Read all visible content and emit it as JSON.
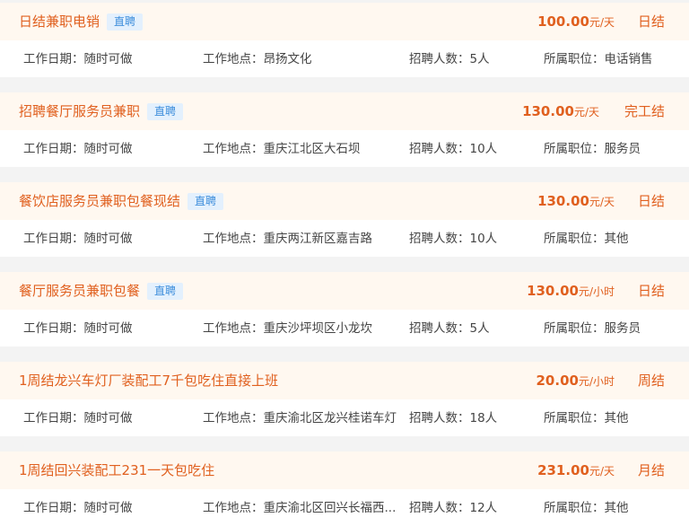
{
  "labels": {
    "date": "工作日期：",
    "location": "工作地点：",
    "count": "招聘人数：",
    "position": "所属职位："
  },
  "jobs": [
    {
      "title": "日结兼职电销",
      "tag": "直聘",
      "salary": "100.00",
      "unit": "元/天",
      "settle": "日结",
      "date": "随时可做",
      "location": "昂扬文化",
      "count": "5人",
      "position": "电话销售"
    },
    {
      "title": "招聘餐厅服务员兼职",
      "tag": "直聘",
      "salary": "130.00",
      "unit": "元/天",
      "settle": "完工结",
      "date": "随时可做",
      "location": "重庆江北区大石坝",
      "count": "10人",
      "position": "服务员"
    },
    {
      "title": "餐饮店服务员兼职包餐现结",
      "tag": "直聘",
      "salary": "130.00",
      "unit": "元/天",
      "settle": "日结",
      "date": "随时可做",
      "location": "重庆两江新区嘉吉路",
      "count": "10人",
      "position": "其他"
    },
    {
      "title": "餐厅服务员兼职包餐",
      "tag": "直聘",
      "salary": "130.00",
      "unit": "元/小时",
      "settle": "日结",
      "date": "随时可做",
      "location": "重庆沙坪坝区小龙坎",
      "count": "5人",
      "position": "服务员"
    },
    {
      "title": "1周结龙兴车灯厂装配工7千包吃住直接上班",
      "tag": "",
      "salary": "20.00",
      "unit": "元/小时",
      "settle": "周结",
      "date": "随时可做",
      "location": "重庆渝北区龙兴桂诺车灯",
      "count": "18人",
      "position": "其他"
    },
    {
      "title": "1周结回兴装配工231一天包吃住",
      "tag": "",
      "salary": "231.00",
      "unit": "元/天",
      "settle": "月结",
      "date": "随时可做",
      "location": "重庆渝北区回兴长福西...",
      "count": "12人",
      "position": "其他"
    }
  ]
}
